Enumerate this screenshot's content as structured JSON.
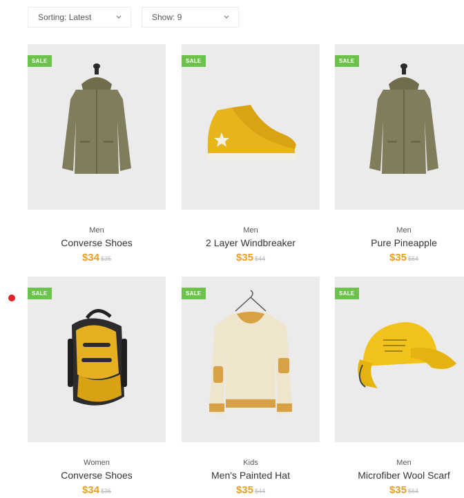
{
  "toolbar": {
    "sort_label": "Sorting: Latest",
    "show_label": "Show: 9"
  },
  "products": [
    {
      "badge": "SALE",
      "category": "Men",
      "name": "Converse Shoes",
      "price": "$34",
      "old_price": "$35",
      "icon": "jacket-icon"
    },
    {
      "badge": "SALE",
      "category": "Men",
      "name": "2 Layer Windbreaker",
      "price": "$35",
      "old_price": "$44",
      "icon": "sneaker-icon"
    },
    {
      "badge": "SALE",
      "category": "Men",
      "name": "Pure Pineapple",
      "price": "$35",
      "old_price": "$64",
      "icon": "jacket-icon"
    },
    {
      "badge": "SALE",
      "category": "Women",
      "name": "Converse Shoes",
      "price": "$34",
      "old_price": "$35",
      "icon": "backpack-icon"
    },
    {
      "badge": "SALE",
      "category": "Kids",
      "name": "Men's Painted Hat",
      "price": "$35",
      "old_price": "$44",
      "icon": "sweater-icon"
    },
    {
      "badge": "SALE",
      "category": "Men",
      "name": "Microfiber Wool Scarf",
      "price": "$35",
      "old_price": "$64",
      "icon": "cap-icon"
    }
  ],
  "colors": {
    "sale_badge": "#6cc24a",
    "price": "#e6a02a",
    "old_price": "#b9b9b9",
    "image_bg": "#ebebeb",
    "indicator_dot": "#e02424"
  }
}
